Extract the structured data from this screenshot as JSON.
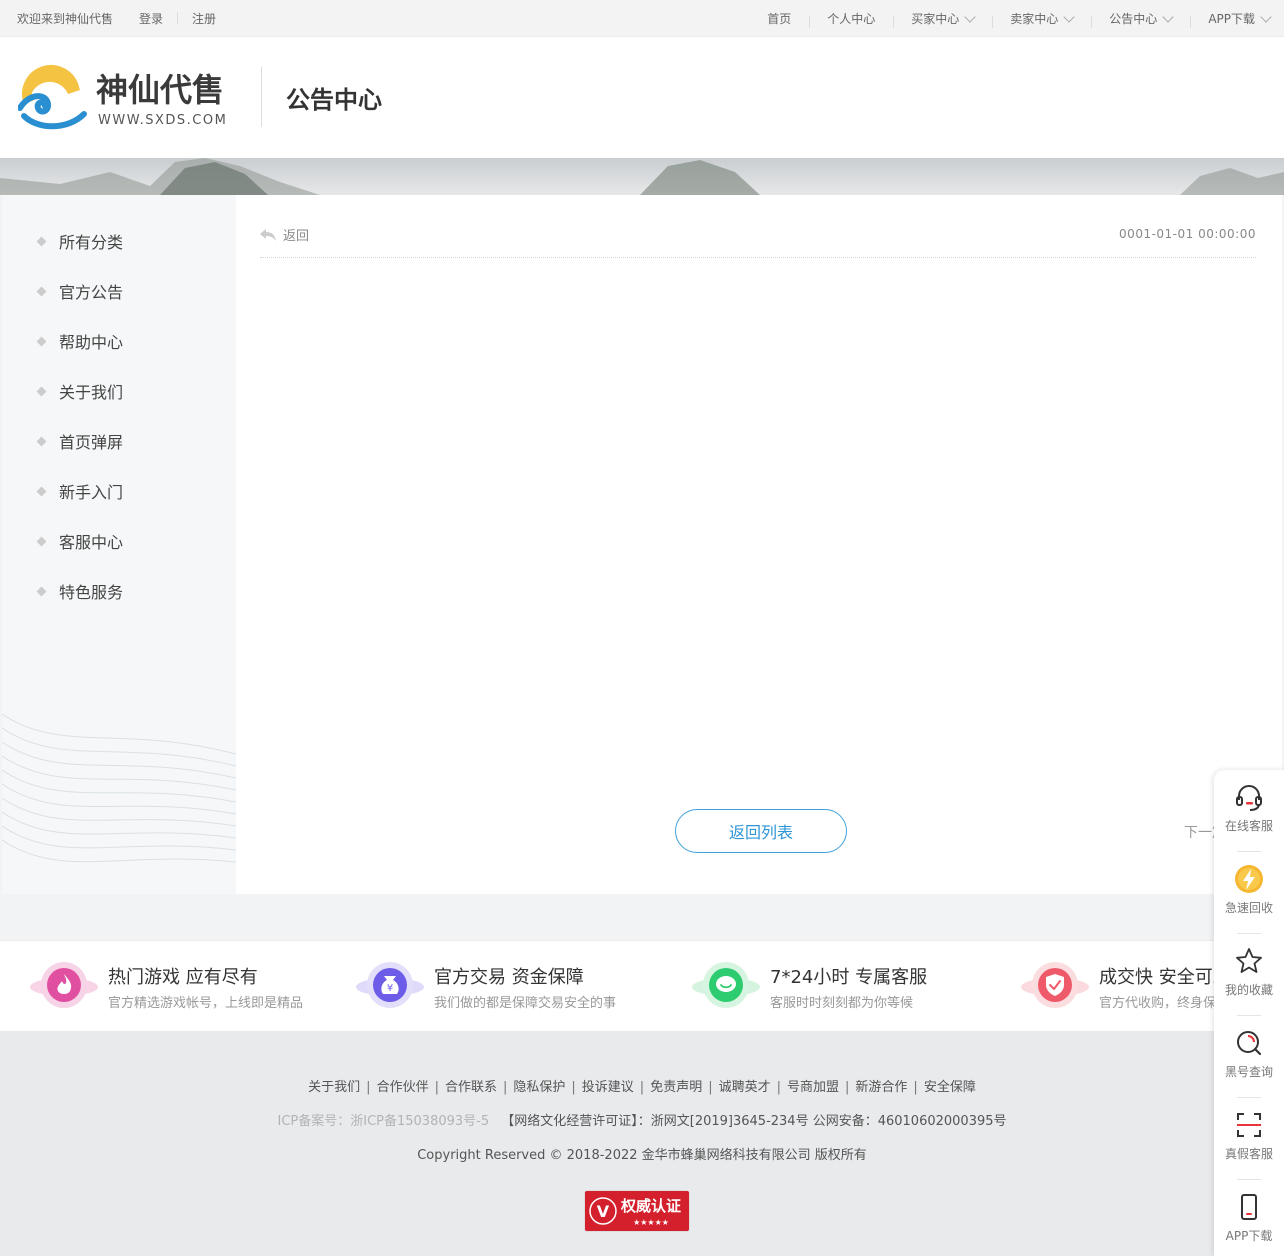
{
  "topbar": {
    "welcome": "欢迎来到神仙代售",
    "login": "登录",
    "register": "注册",
    "nav": [
      {
        "label": "首页",
        "dropdown": false
      },
      {
        "label": "个人中心",
        "dropdown": false
      },
      {
        "label": "买家中心",
        "dropdown": true
      },
      {
        "label": "卖家中心",
        "dropdown": true
      },
      {
        "label": "公告中心",
        "dropdown": true
      },
      {
        "label": "APP下载",
        "dropdown": true
      }
    ]
  },
  "header": {
    "logo_text": "神仙代售",
    "logo_url_text": "WWW.SXDS.COM",
    "title": "公告中心"
  },
  "sidebar": {
    "items": [
      "所有分类",
      "官方公告",
      "帮助中心",
      "关于我们",
      "首页弹屏",
      "新手入门",
      "客服中心",
      "特色服务"
    ]
  },
  "article": {
    "back_label": "返回",
    "date": "0001-01-01 00:00:00",
    "back_to_list": "返回列表",
    "next_label": "下一篇"
  },
  "features": [
    {
      "title": "热门游戏 应有尽有",
      "desc": "官方精选游戏帐号，上线即是精品",
      "icon": "fire-icon",
      "color": "#e04fa0"
    },
    {
      "title": "官方交易 资金保障",
      "desc": "我们做的都是保障交易安全的事",
      "icon": "money-bag-icon",
      "color": "#6c5ce7"
    },
    {
      "title": "7*24小时 专属客服",
      "desc": "客服时时刻刻都为你等候",
      "icon": "chat-icon",
      "color": "#2ecc71"
    },
    {
      "title": "成交快 安全可靠",
      "desc": "官方代收购，终身保障",
      "icon": "shield-check-icon",
      "color": "#ef5a6b"
    }
  ],
  "footer": {
    "links": [
      "关于我们",
      "合作伙伴",
      "合作联系",
      "隐私保护",
      "投诉建议",
      "免责声明",
      "诚聘英才",
      "号商加盟",
      "新游合作",
      "安全保障"
    ],
    "icp": "ICP备案号：浙ICP备15038093号-5",
    "license": "【网络文化经营许可证】：浙网文[2019]3645-234号 公网安备：46010602000395号",
    "copyright": "Copyright Reserved © 2018-2022 金华市蜂巢网络科技有限公司 版权所有",
    "badge_text": "权威认证",
    "badge_stars": "★★★★★"
  },
  "float_bar": [
    {
      "label": "在线客服",
      "icon": "headset-icon"
    },
    {
      "label": "急速回收",
      "icon": "lightning-icon"
    },
    {
      "label": "我的收藏",
      "icon": "star-icon"
    },
    {
      "label": "黑号查询",
      "icon": "search-icon"
    },
    {
      "label": "真假客服",
      "icon": "scan-icon"
    },
    {
      "label": "APP下载",
      "icon": "phone-icon"
    }
  ],
  "colors": {
    "accent_blue": "#2e95d6",
    "logo_yellow": "#f5c342",
    "logo_blue": "#2a8fd0",
    "float_red": "#e8343a"
  }
}
